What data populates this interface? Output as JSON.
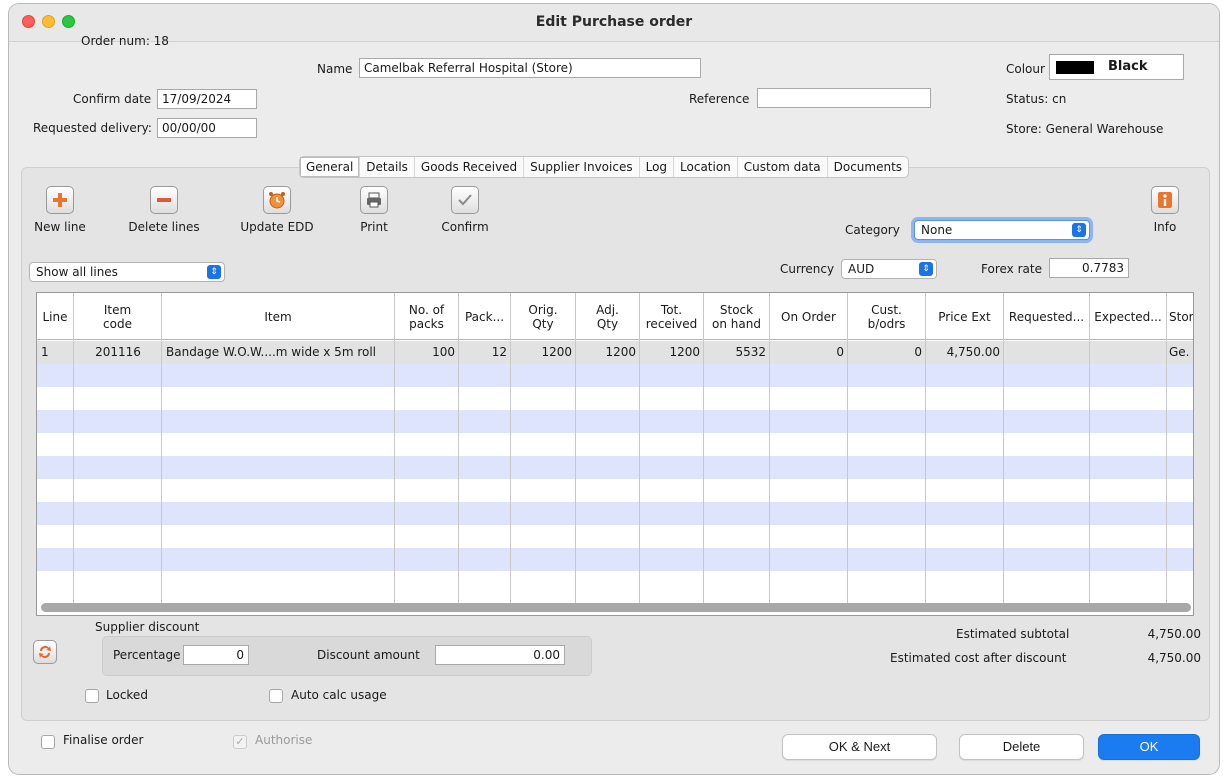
{
  "window": {
    "title": "Edit Purchase order"
  },
  "header": {
    "order_num": "Order num: 18",
    "confirm_date_label": "Confirm date",
    "confirm_date": "17/09/2024",
    "requested_delivery_label": "Requested delivery:",
    "requested_delivery": "00/00/00",
    "name_label": "Name",
    "name_value": "Camelbak Referral Hospital (Store)",
    "reference_label": "Reference",
    "reference_value": "",
    "colour_label": "Colour",
    "colour_value": "Black",
    "colour_swatch": "#000000",
    "status": "Status: cn",
    "store": "Store: General Warehouse"
  },
  "tabs": [
    "General",
    "Details",
    "Goods Received",
    "Supplier Invoices",
    "Log",
    "Location",
    "Custom data",
    "Documents"
  ],
  "toolbar": {
    "new_line": "New line",
    "delete_lines": "Delete lines",
    "update_edd": "Update EDD",
    "print": "Print",
    "confirm": "Confirm",
    "info": "Info",
    "category_label": "Category",
    "category_value": "None",
    "currency_label": "Currency",
    "currency_value": "AUD",
    "forex_label": "Forex rate",
    "forex_value": "0.7783",
    "filter_value": "Show all lines"
  },
  "table": {
    "columns": [
      "Line",
      "Item\ncode",
      "Item",
      "No. of\npacks",
      "Pack...",
      "Orig.\nQty",
      "Adj.\nQty",
      "Tot.\nreceived",
      "Stock\non hand",
      "On Order",
      "Cust.\nb/odrs",
      "Price Ext",
      "Requested...",
      "Expected...",
      "Stor"
    ],
    "rows": [
      [
        "1",
        "201116",
        "Bandage W.O.W....m wide x 5m roll",
        "100",
        "12",
        "1200",
        "1200",
        "1200",
        "5532",
        "0",
        "0",
        "4,750.00",
        "",
        "",
        "Ge."
      ]
    ]
  },
  "discount": {
    "group_label": "Supplier discount",
    "percentage_label": "Percentage",
    "percentage_value": "0",
    "amount_label": "Discount amount",
    "amount_value": "0.00",
    "locked_label": "Locked",
    "auto_calc_label": "Auto calc usage"
  },
  "totals": {
    "subtotal_label": "Estimated subtotal",
    "subtotal_value": "4,750.00",
    "after_discount_label": "Estimated cost after discount",
    "after_discount_value": "4,750.00"
  },
  "footer": {
    "finalise_label": "Finalise order",
    "authorise_label": "Authorise",
    "ok_next": "OK & Next",
    "delete": "Delete",
    "ok": "OK"
  },
  "colors": {
    "accent": "#1a7cf0",
    "row_alt": "#dee4fb",
    "red": "#fe5f57",
    "yellow": "#febc2e",
    "green": "#28c840"
  },
  "icons": [
    "plus-icon",
    "minus-icon",
    "clock-icon",
    "printer-icon",
    "checkmark-icon",
    "info-icon",
    "refresh-icon",
    "chevron-updown-icon"
  ]
}
